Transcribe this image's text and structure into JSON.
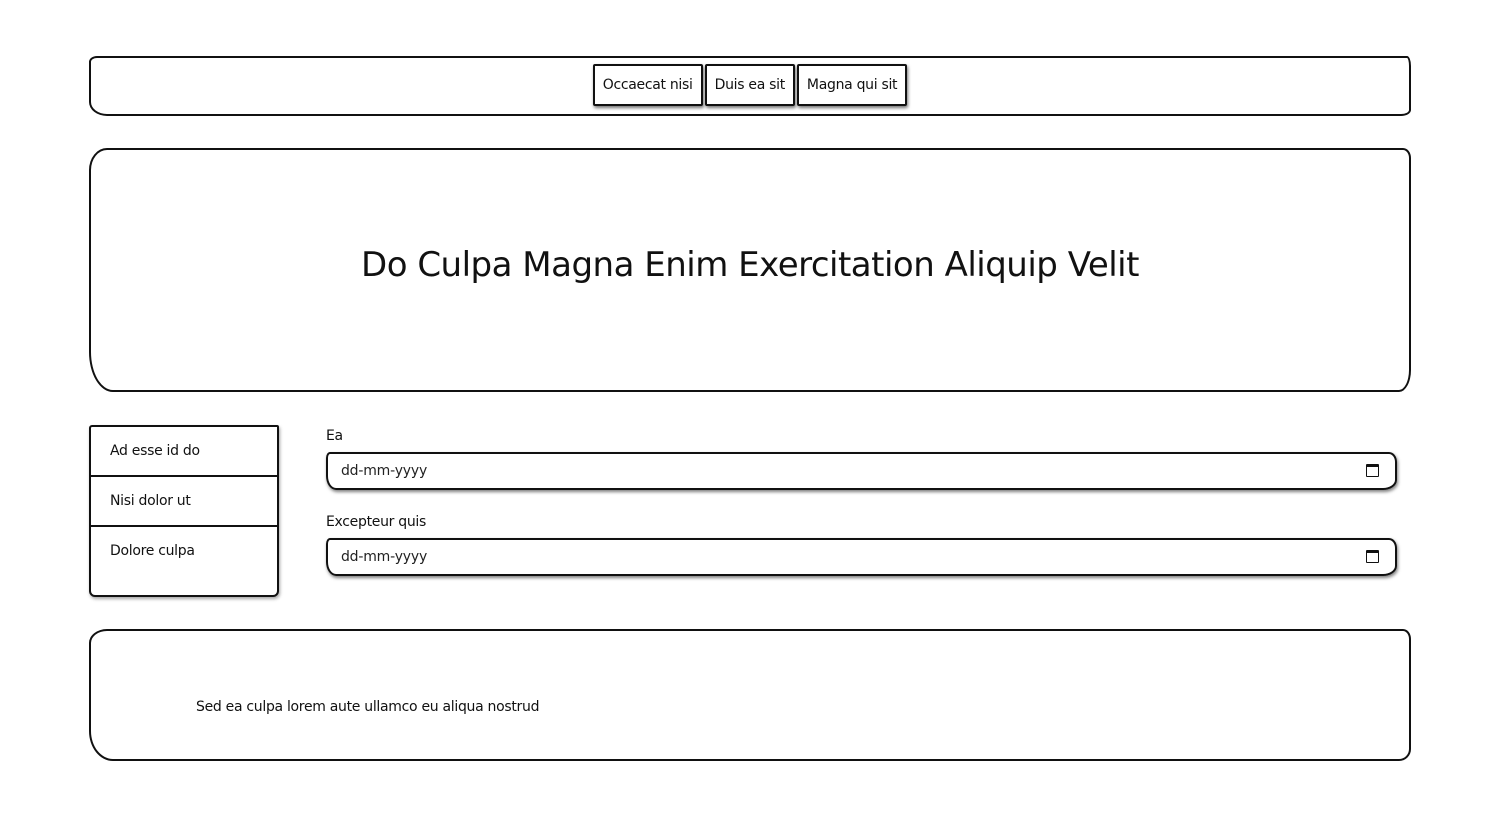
{
  "nav": {
    "items": [
      {
        "label": "Occaecat nisi"
      },
      {
        "label": "Duis ea sit"
      },
      {
        "label": "Magna qui sit"
      }
    ]
  },
  "hero": {
    "title": "Do Culpa Magna Enim Exercitation Aliquip Velit"
  },
  "sidebar": {
    "items": [
      {
        "label": "Ad esse id do"
      },
      {
        "label": "Nisi dolor ut"
      },
      {
        "label": "Dolore culpa"
      }
    ]
  },
  "form": {
    "fields": [
      {
        "label": "Ea",
        "placeholder": "dd-mm-yyyy",
        "icon": "calendar-icon"
      },
      {
        "label": "Excepteur quis",
        "placeholder": "dd-mm-yyyy",
        "icon": "calendar-icon"
      }
    ]
  },
  "footer": {
    "text": "Sed ea culpa lorem aute ullamco eu aliqua nostrud"
  }
}
